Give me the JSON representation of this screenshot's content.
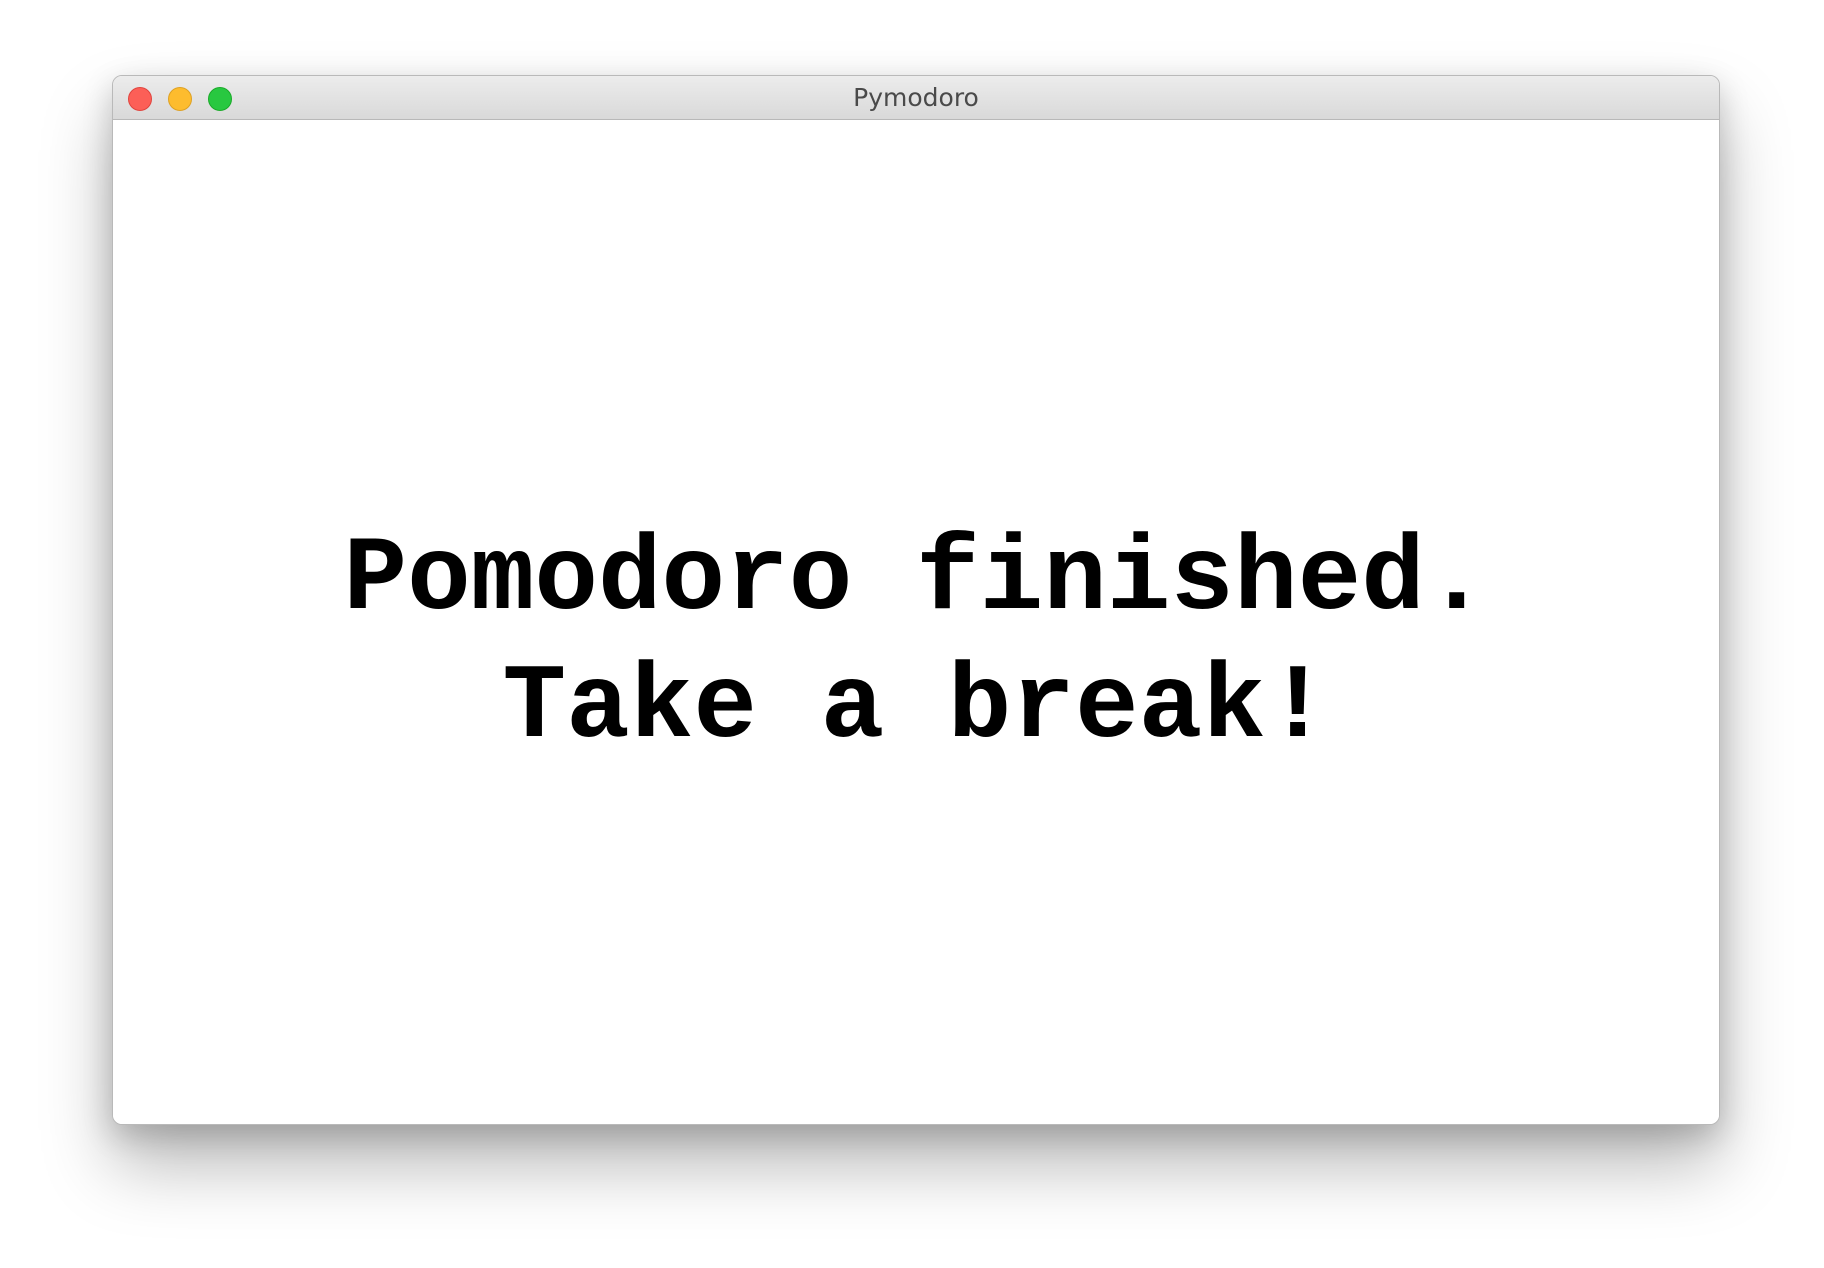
{
  "window": {
    "title": "Pymodoro",
    "controls": {
      "close_color": "#fc5f57",
      "minimize_color": "#fdbc2e",
      "zoom_color": "#28c840"
    }
  },
  "main": {
    "message_line1": "Pomodoro finished.",
    "message_line2": "Take a break!"
  }
}
